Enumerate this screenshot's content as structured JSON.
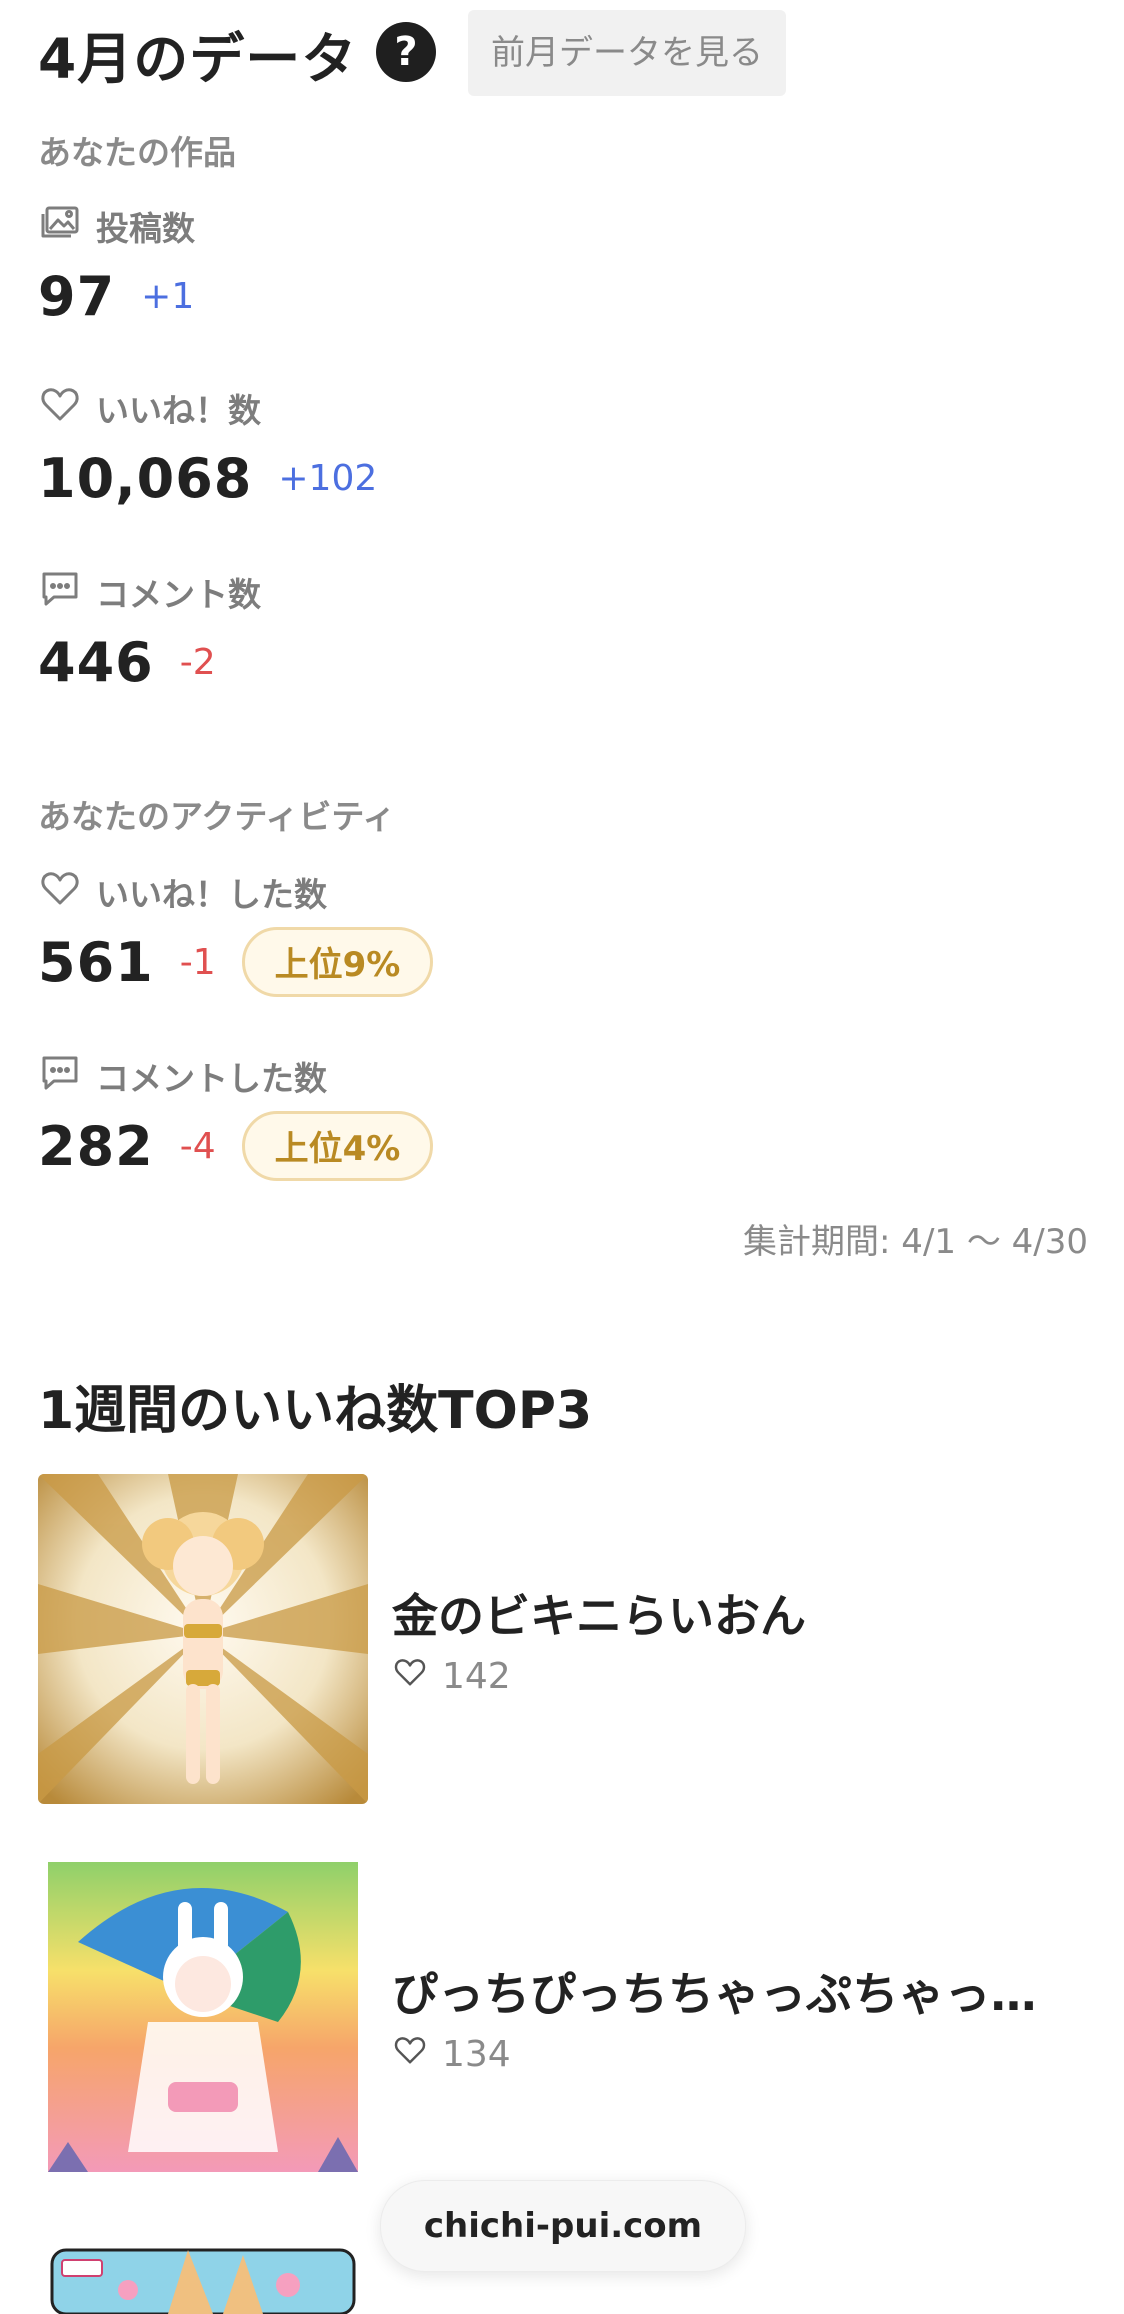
{
  "header": {
    "title": "4月のデータ",
    "help_icon_glyph": "?",
    "prev_month_button": "前月データを見る"
  },
  "works": {
    "label": "あなたの作品",
    "posts": {
      "label": "投稿数",
      "icon": "gallery-icon",
      "value": "97",
      "delta": "+1"
    },
    "likes": {
      "label": "いいね！数",
      "icon": "heart-icon",
      "value": "10,068",
      "delta": "+102"
    },
    "comments": {
      "label": "コメント数",
      "icon": "comment-icon",
      "value": "446",
      "delta": "-2"
    }
  },
  "activity": {
    "label": "あなたのアクティビティ",
    "likes_given": {
      "label": "いいね！した数",
      "icon": "heart-icon",
      "value": "561",
      "delta": "-1",
      "rank": "上位9%"
    },
    "comments_given": {
      "label": "コメントした数",
      "icon": "comment-icon",
      "value": "282",
      "delta": "-4",
      "rank": "上位4%"
    }
  },
  "period": "集計期間: 4/1 〜 4/30",
  "top3": {
    "title": "1週間のいいね数TOP3",
    "items": [
      {
        "title": "金のビキニらいおん",
        "likes": "142"
      },
      {
        "title": "ぴっちぴっちちゃっぷちゃっ…",
        "likes": "134"
      }
    ]
  },
  "site_pill": "chichi-pui.com",
  "colors": {
    "delta_up": "#4c6fe0",
    "delta_down": "#e05050",
    "rank_text": "#b98a23",
    "rank_border": "#f0d9a8",
    "muted": "#8a8a8a"
  }
}
